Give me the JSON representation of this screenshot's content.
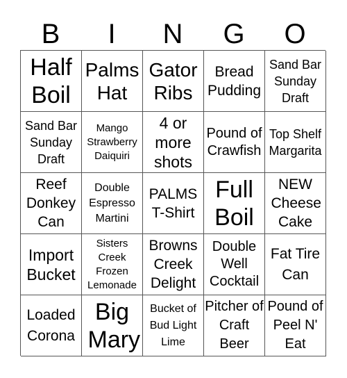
{
  "header": {
    "letters": [
      "B",
      "I",
      "N",
      "G",
      "O"
    ]
  },
  "cells": [
    "Half Boil",
    "Palms Hat",
    "Gator Ribs",
    "Bread Pudding",
    "Sand Bar Sunday Draft",
    "Sand Bar Sunday Draft",
    "Mango Strawberry Daiquiri",
    "4 or more shots",
    "Pound of Crawfish",
    "Top Shelf Margarita",
    "Reef Donkey Can",
    "Double Espresso Martini",
    "PALMS T-Shirt",
    "Full Boil",
    "NEW Cheese Cake",
    "Import Bucket",
    "Sisters Creek Frozen Lemonade",
    "Browns Creek Delight",
    "Double Well Cocktail",
    "Fat Tire Can",
    "Loaded Corona",
    "Big Mary",
    "Bucket of Bud Light Lime",
    "Pitcher of Craft Beer",
    "Pound of Peel N' Eat"
  ]
}
